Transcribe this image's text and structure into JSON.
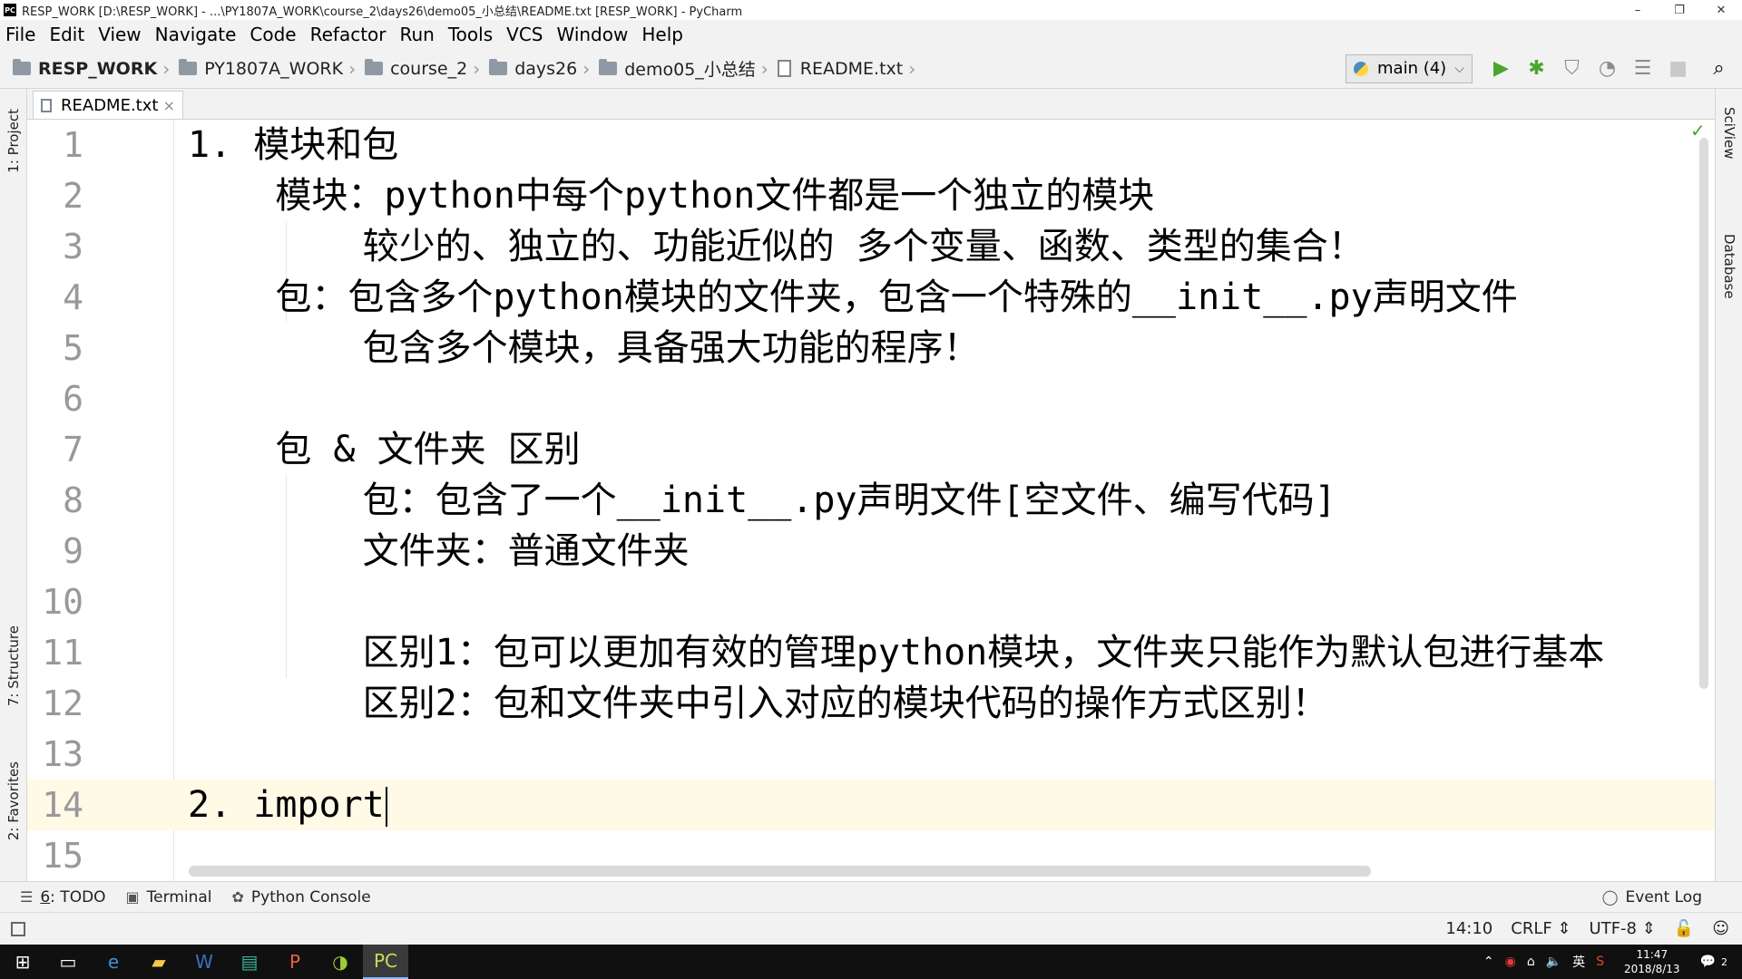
{
  "window": {
    "title": "RESP_WORK [D:\\RESP_WORK] - ...\\PY1807A_WORK\\course_2\\days26\\demo05_小总结\\README.txt [RESP_WORK] - PyCharm",
    "app_icon": "PC",
    "minimize": "–",
    "maximize": "❐",
    "close": "✕"
  },
  "menu": [
    "File",
    "Edit",
    "View",
    "Navigate",
    "Code",
    "Refactor",
    "Run",
    "Tools",
    "VCS",
    "Window",
    "Help"
  ],
  "breadcrumbs": [
    "RESP_WORK",
    "PY1807A_WORK",
    "course_2",
    "days26",
    "demo05_小总结",
    "README.txt"
  ],
  "run_config": {
    "label": "main (4)"
  },
  "toolbar_icons": {
    "run": "▶",
    "debug": "✱",
    "coverage": "⛉",
    "profile": "◔",
    "concurrency": "☰",
    "stop": "■",
    "search": "⌕"
  },
  "tabs": [
    {
      "label": "README.txt",
      "close": "×"
    }
  ],
  "left_tools": [
    "1: Project",
    "7: Structure",
    "2: Favorites"
  ],
  "right_tools": [
    "SciView",
    "Database"
  ],
  "editor": {
    "lines": [
      {
        "n": "1",
        "text": "1. 模块和包"
      },
      {
        "n": "2",
        "text": "    模块：python中每个python文件都是一个独立的模块"
      },
      {
        "n": "3",
        "text": "        较少的、独立的、功能近似的 多个变量、函数、类型的集合！"
      },
      {
        "n": "4",
        "text": "    包：包含多个python模块的文件夹，包含一个特殊的__init__.py声明文件"
      },
      {
        "n": "5",
        "text": "        包含多个模块，具备强大功能的程序！"
      },
      {
        "n": "6",
        "text": ""
      },
      {
        "n": "7",
        "text": "    包 & 文件夹 区别"
      },
      {
        "n": "8",
        "text": "        包：包含了一个__init__.py声明文件[空文件、编写代码]"
      },
      {
        "n": "9",
        "text": "        文件夹：普通文件夹"
      },
      {
        "n": "10",
        "text": ""
      },
      {
        "n": "11",
        "text": "        区别1：包可以更加有效的管理python模块，文件夹只能作为默认包进行基本"
      },
      {
        "n": "12",
        "text": "        区别2：包和文件夹中引入对应的模块代码的操作方式区别！"
      },
      {
        "n": "13",
        "text": ""
      },
      {
        "n": "14",
        "text": "2. import"
      },
      {
        "n": "15",
        "text": ""
      }
    ],
    "current_line": 14
  },
  "bottom_tools": {
    "todo_num": "6",
    "todo_label": ": TODO",
    "terminal": "Terminal",
    "python_console": "Python Console",
    "event_log": "Event Log"
  },
  "status": {
    "position": "14:10",
    "line_sep": "CRLF ⇕",
    "encoding": "UTF-8 ⇕"
  },
  "taskbar": {
    "ime": "英",
    "time": "11:47",
    "date": "2018/8/13",
    "notifications": "2"
  },
  "colors": {
    "current_line": "#fefae6",
    "run_green": "#4aa52e",
    "gutter_text": "#999999"
  }
}
